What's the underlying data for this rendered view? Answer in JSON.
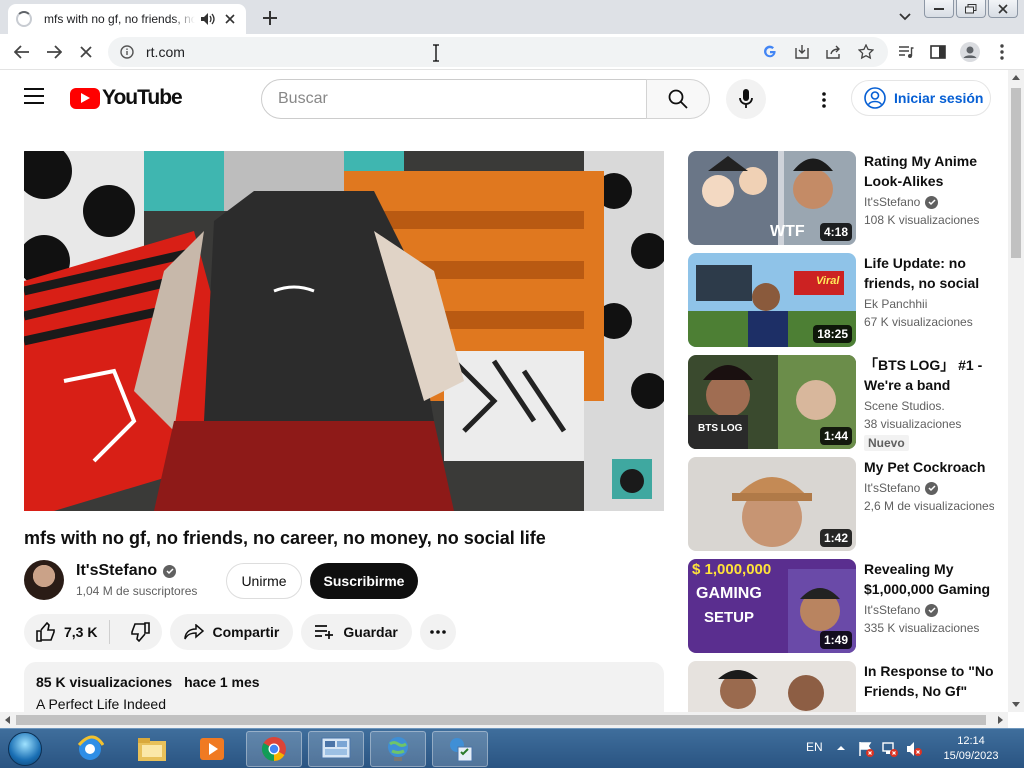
{
  "browser": {
    "tab_title": "mfs with no gf, no friends, no career, no money, no social life",
    "url": "rt.com"
  },
  "header": {
    "logo_text": "YouTube",
    "search_placeholder": "Buscar",
    "signin_label": "Iniciar sesión"
  },
  "video": {
    "title": "mfs with no gf, no friends, no career, no money, no social life",
    "channel_name": "It'sStefano",
    "subscribers": "1,04 M de suscriptores",
    "join_label": "Unirme",
    "subscribe_label": "Suscribirme",
    "likes": "7,3 K",
    "share_label": "Compartir",
    "save_label": "Guardar",
    "views": "85 K visualizaciones",
    "date": "hace 1 mes",
    "description": "A Perfect Life Indeed"
  },
  "recommendations": [
    {
      "title": "Rating My Anime Look-Alikes",
      "channel": "It'sStefano",
      "verified": true,
      "views": "108 K visualizaciones",
      "duration": "4:18",
      "badge": ""
    },
    {
      "title": "Life Update: no friends, no social life",
      "channel": "Ek Panchhii",
      "verified": false,
      "views": "67 K visualizaciones",
      "duration": "18:25",
      "badge": ""
    },
    {
      "title": "「BTS LOG」 #1 - We're a band",
      "channel": "Scene Studios.",
      "verified": false,
      "views": "38 visualizaciones",
      "duration": "1:44",
      "badge": "Nuevo"
    },
    {
      "title": "My Pet Cockroach",
      "channel": "It'sStefano",
      "verified": true,
      "views": "2,6 M de visualizaciones",
      "duration": "1:42",
      "badge": ""
    },
    {
      "title": "Revealing My $1,000,000 Gaming Setup",
      "channel": "It'sStefano",
      "verified": true,
      "views": "335 K visualizaciones",
      "duration": "1:49",
      "badge": ""
    },
    {
      "title": "In Response to \"No Friends, No Gf\"",
      "channel": "",
      "verified": false,
      "views": "",
      "duration": "",
      "badge": ""
    }
  ],
  "thumb_text": {
    "rec1": "WTF",
    "rec2": "Viral",
    "rec3": "BTS LOG",
    "rec5_top": "$ 1,000,000",
    "rec5_mid": "GAMING",
    "rec5_bottom": "SETUP"
  },
  "taskbar": {
    "language": "EN",
    "time": "12:14",
    "date": "15/09/2023"
  },
  "colors": {
    "youtube_red": "#ff0000",
    "link_blue": "#065fd4",
    "taskbar": "#2a5482"
  }
}
